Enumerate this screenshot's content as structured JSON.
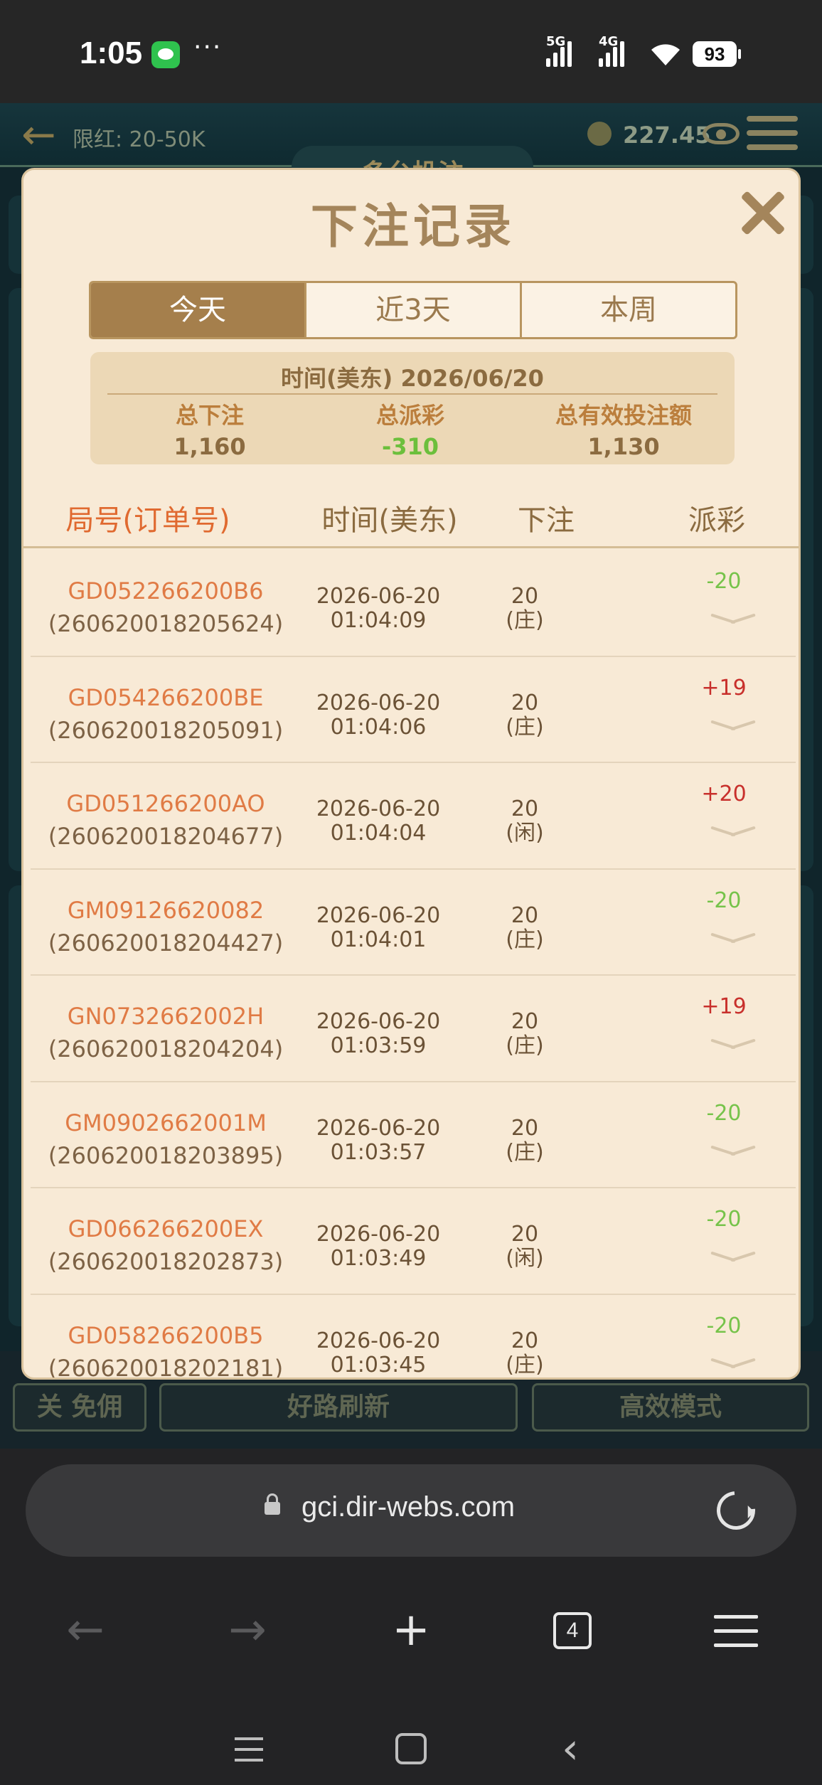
{
  "status_bar": {
    "time": "1:05",
    "more": "···",
    "signal1": "5G",
    "signal2": "4G",
    "battery": "93"
  },
  "game": {
    "limit": "限红: 20-50K",
    "balance": "227.45",
    "title": "多台投注",
    "bottom_buttons": [
      "关 免佣",
      "好路刷新",
      "高效模式"
    ]
  },
  "modal": {
    "title": "下注记录",
    "tabs": [
      "今天",
      "近3天",
      "本周"
    ],
    "active_tab": "今天",
    "summary": {
      "date_line": "时间(美东) 2026/06/20",
      "total_bet_label": "总下注",
      "total_bet": "1,160",
      "total_payout_label": "总派彩",
      "total_payout": "-310",
      "total_valid_label": "总有效投注额",
      "total_valid": "1,130"
    },
    "columns": [
      "局号(订单号)",
      "时间(美东)",
      "下注",
      "派彩"
    ],
    "rows": [
      {
        "game_id": "GD052266200B6",
        "order_no": "(260620018205624)",
        "date": "2026-06-20",
        "time": "01:04:09",
        "bet": "20",
        "side": "(庄)",
        "payout": "-20"
      },
      {
        "game_id": "GD054266200BE",
        "order_no": "(260620018205091)",
        "date": "2026-06-20",
        "time": "01:04:06",
        "bet": "20",
        "side": "(庄)",
        "payout": "+19"
      },
      {
        "game_id": "GD051266200AO",
        "order_no": "(260620018204677)",
        "date": "2026-06-20",
        "time": "01:04:04",
        "bet": "20",
        "side": "(闲)",
        "payout": "+20"
      },
      {
        "game_id": "GM09126620082",
        "order_no": "(260620018204427)",
        "date": "2026-06-20",
        "time": "01:04:01",
        "bet": "20",
        "side": "(庄)",
        "payout": "-20"
      },
      {
        "game_id": "GN0732662002H",
        "order_no": "(260620018204204)",
        "date": "2026-06-20",
        "time": "01:03:59",
        "bet": "20",
        "side": "(庄)",
        "payout": "+19"
      },
      {
        "game_id": "GM0902662001M",
        "order_no": "(260620018203895)",
        "date": "2026-06-20",
        "time": "01:03:57",
        "bet": "20",
        "side": "(庄)",
        "payout": "-20"
      },
      {
        "game_id": "GD066266200EX",
        "order_no": "(260620018202873)",
        "date": "2026-06-20",
        "time": "01:03:49",
        "bet": "20",
        "side": "(闲)",
        "payout": "-20"
      },
      {
        "game_id": "GD058266200B5",
        "order_no": "(260620018202181)",
        "date": "2026-06-20",
        "time": "01:03:45",
        "bet": "20",
        "side": "(庄)",
        "payout": "-20"
      }
    ]
  },
  "browser": {
    "url": "gci.dir-webs.com",
    "tab_count": "4",
    "icons": [
      "back-icon",
      "forward-icon",
      "new-tab-icon",
      "tabs-icon",
      "menu-icon",
      "reload-icon",
      "lock-icon"
    ]
  },
  "colors": {
    "accent": "#a57f4c",
    "win": "#c8302c",
    "loss": "#76c34a",
    "game_id": "#e07b45"
  }
}
